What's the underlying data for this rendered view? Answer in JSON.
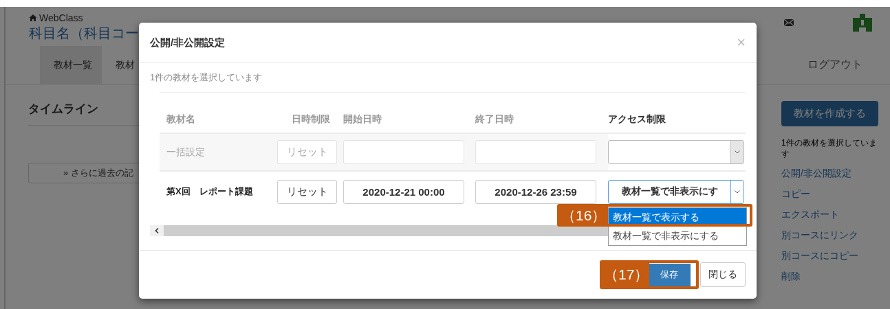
{
  "page": {
    "brand": "WebClass",
    "course_title": "科目名（科目コー",
    "tabs": [
      {
        "label": "教材一覧",
        "selected": true
      },
      {
        "label": "教材",
        "selected": false
      }
    ],
    "logout": "ログアウト",
    "section_title": "タイムライン",
    "more_button": "» さらに過去の記",
    "sidebar": {
      "create_button": "教材を作成する",
      "selection_note": "1件の教材を選択しています",
      "links": [
        "公開/非公開設定",
        "コピー",
        "エクスポート",
        "別コースにリンク",
        "別コースにコピー",
        "削除"
      ]
    }
  },
  "dialog": {
    "title": "公開/非公開設定",
    "close": "×",
    "selection_note": "1件の教材を選択しています",
    "columns": [
      "教材名",
      "日時制限",
      "開始日時",
      "終了日時",
      "アクセス制限"
    ],
    "rows": [
      {
        "kind": "bulk",
        "name": "一括設定",
        "reset": "リセット"
      },
      {
        "kind": "item",
        "name": "第X回　レポート課題",
        "reset": "リセット",
        "start": "2020-12-21 00:00",
        "end": "2020-12-26 23:59",
        "access": "教材一覧で非表示にす"
      }
    ],
    "dropdown": [
      {
        "label": "教材一覧で表示する",
        "selected": true
      },
      {
        "label": "教材一覧で非表示にする",
        "selected": false
      }
    ],
    "save_button": "保存",
    "close_button": "閉じる"
  },
  "callouts": [
    {
      "kind": "dropdown",
      "label": "（16）"
    },
    {
      "kind": "save",
      "label": "（17）"
    }
  ]
}
